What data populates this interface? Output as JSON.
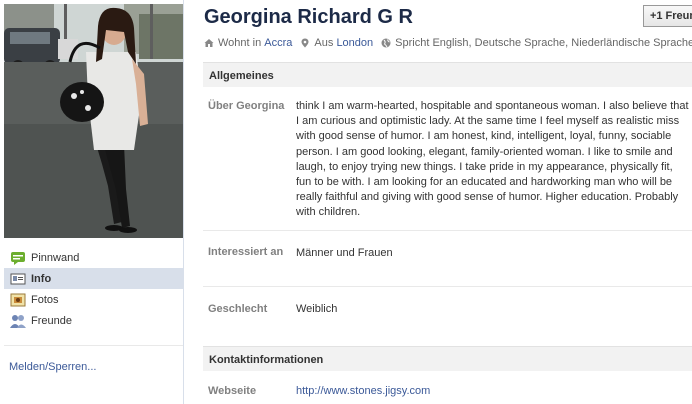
{
  "profile": {
    "name": "Georgina Richard G R",
    "friend_button_label": "Freunde"
  },
  "meta": {
    "lives_prefix": "Wohnt in",
    "lives_city": "Accra",
    "from_prefix": "Aus",
    "from_city": "London",
    "languages": "Spricht English, Deutsche Sprache, Niederländische Sprache"
  },
  "nav": {
    "items": [
      {
        "label": "Pinnwand",
        "icon": "wall-icon"
      },
      {
        "label": "Info",
        "icon": "info-icon"
      },
      {
        "label": "Fotos",
        "icon": "photos-icon"
      },
      {
        "label": "Freunde",
        "icon": "friends-icon"
      }
    ],
    "active_index": 1,
    "report_label": "Melden/Sperren..."
  },
  "sections": {
    "general": {
      "title": "Allgemeines",
      "about_label": "Über Georgina",
      "about_text": "think I am warm-hearted, hospitable and spontaneous woman. I also believe that I am curious and optimistic lady. At the same time I feel myself as realistic miss with good sense of humor. I am honest, kind, intelligent, loyal, funny, sociable person. I am good looking, elegant, family-oriented woman. I like to smile and laugh, to enjoy trying new things. I take pride in my appearance, physically fit, fun to be with. I am looking for an educated and hardworking man who will be really faithful and giving with good sense of humor. Higher education. Probably with children.",
      "interested_label": "Interessiert an",
      "interested_value": "Männer und Frauen",
      "gender_label": "Geschlecht",
      "gender_value": "Weiblich"
    },
    "contact": {
      "title": "Kontaktinformationen",
      "website_label": "Webseite",
      "website_value": "http://www.stones.jigsy.com"
    }
  },
  "colors": {
    "link": "#3b5998",
    "name": "#1c2a47",
    "label": "#808080",
    "header_bg": "#f2f2f2",
    "active_nav_bg": "#d8dfea"
  }
}
